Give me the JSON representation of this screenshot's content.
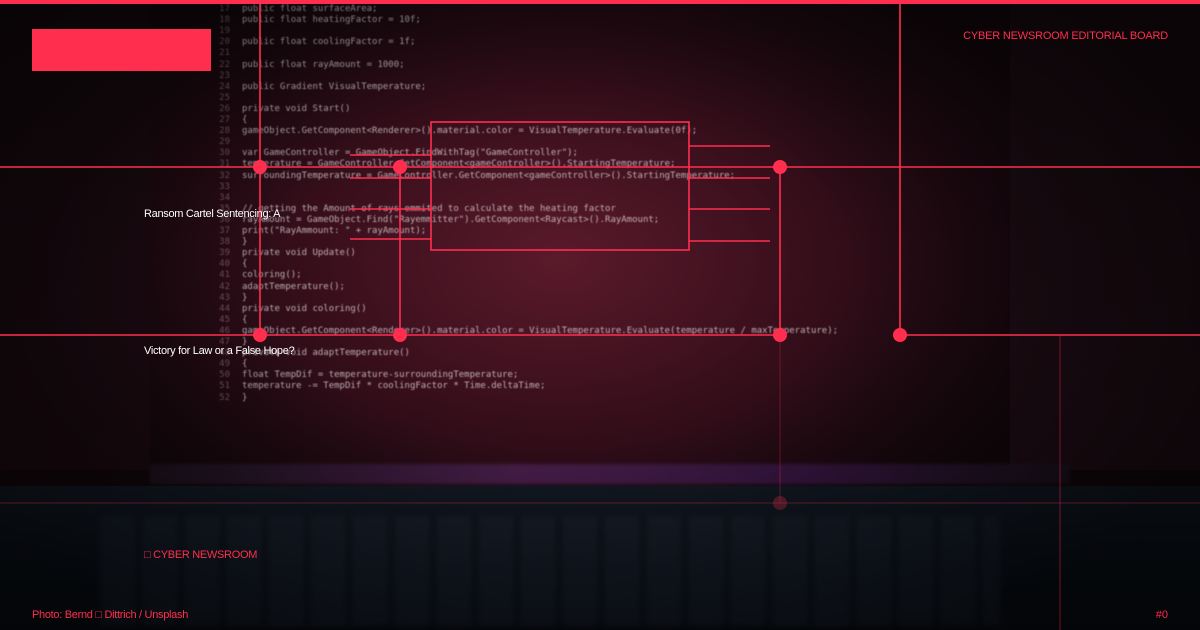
{
  "header": {
    "board_label": "CYBER NEWSROOM EDITORIAL BOARD"
  },
  "headline": {
    "line1": "Ransom Cartel Sentencing: A",
    "line2": "Victory for Law or a False Hope?"
  },
  "brand": {
    "label": "□ CYBER NEWSROOM"
  },
  "footer": {
    "photo_credit": "Photo: Bernd □ Dittrich / Unsplash",
    "page_number": "#0"
  },
  "colors": {
    "accent": "#ff2e4f",
    "text": "#ffffff"
  },
  "background_code": {
    "line_numbers": [
      "17",
      "18",
      "19",
      "20",
      "21",
      "22",
      "23",
      "24",
      "25",
      "26",
      "27",
      "28",
      "29",
      "30",
      "31",
      "32",
      "33",
      "34",
      "35",
      "36",
      "37",
      "38",
      "39",
      "40",
      "41",
      "42",
      "43",
      "44",
      "45",
      "46",
      "47",
      "48",
      "49",
      "50",
      "51",
      "52"
    ],
    "lines": [
      "public float surfaceArea;",
      "public float heatingFactor = 10f;",
      "",
      "public float coolingFactor = 1f;",
      "",
      "public float rayAmount = 1000;",
      "",
      "public Gradient VisualTemperature;",
      "",
      "private void Start()",
      "{",
      "  gameObject.GetComponent<Renderer>().material.color = VisualTemperature.Evaluate(0f);",
      "",
      "  var GameController = GameObject.FindWithTag(\"GameController\");",
      "  temperature = GameController.GetComponent<gameController>().StartingTemperature;",
      "  surroundingTemperature = GameController.GetComponent<gameController>().StartingTemperature;",
      "",
      "",
      "  // getting the Amount of rays emmited to calculate the heating factor",
      "  rayAmount = GameObject.Find(\"Rayemmitter\").GetComponent<Raycast>().RayAmount;",
      "  print(\"RayAmmount: \" + rayAmount);",
      "}",
      "private void Update()",
      "{",
      "  coloring();",
      "  adaptTemperature();",
      "}",
      "private void coloring()",
      "{",
      "  gameObject.GetComponent<Renderer>().material.color = VisualTemperature.Evaluate(temperature / maxTemperature);",
      "}",
      "private void adaptTemperature()",
      "{",
      "  float TempDif = temperature-surroundingTemperature;",
      "  temperature -= TempDif * coolingFactor * Time.deltaTime;",
      "}"
    ]
  }
}
